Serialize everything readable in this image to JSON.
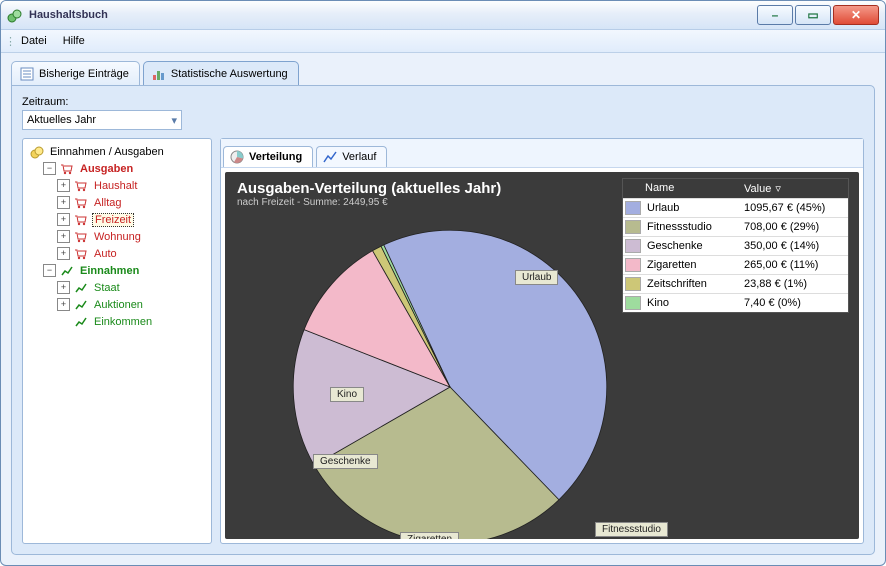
{
  "window": {
    "title": "Haushaltsbuch"
  },
  "menubar": {
    "items": [
      "Datei",
      "Hilfe"
    ]
  },
  "main_tabs": {
    "previous": "Bisherige Einträge",
    "stats": "Statistische Auswertung"
  },
  "period": {
    "label": "Zeitraum:",
    "value": "Aktuelles Jahr"
  },
  "tree": {
    "root": "Einnahmen / Ausgaben",
    "ausgaben": {
      "label": "Ausgaben",
      "children": [
        "Haushalt",
        "Alltag",
        "Freizeit",
        "Wohnung",
        "Auto"
      ]
    },
    "einnahmen": {
      "label": "Einnahmen",
      "children": [
        "Staat",
        "Auktionen",
        "Einkommen"
      ]
    }
  },
  "sub_tabs": {
    "distribution": "Verteilung",
    "history": "Verlauf"
  },
  "chart": {
    "title": "Ausgaben-Verteilung (aktuelles Jahr)",
    "subtitle": "nach Freizeit - Summe: 2449,95 €",
    "legend_headers": {
      "name": "Name",
      "value": "Value"
    },
    "rows": [
      {
        "name": "Urlaub",
        "value": "1095,67 € (45%)",
        "color": "#a3aee0"
      },
      {
        "name": "Fitnessstudio",
        "value": "708,00 € (29%)",
        "color": "#b7bb8f"
      },
      {
        "name": "Geschenke",
        "value": "350,00 € (14%)",
        "color": "#cdbcd3"
      },
      {
        "name": "Zigaretten",
        "value": "265,00 € (11%)",
        "color": "#f3b9c9"
      },
      {
        "name": "Zeitschriften",
        "value": "23,88 € (1%)",
        "color": "#cdc777"
      },
      {
        "name": "Kino",
        "value": "7,40 € (0%)",
        "color": "#9edc9e"
      }
    ]
  },
  "chart_data": {
    "type": "pie",
    "title": "Ausgaben-Verteilung (aktuelles Jahr)",
    "subtitle": "nach Freizeit - Summe: 2449,95 €",
    "total": 2449.95,
    "categories": [
      "Urlaub",
      "Fitnessstudio",
      "Geschenke",
      "Zigaretten",
      "Zeitschriften",
      "Kino"
    ],
    "values": [
      1095.67,
      708.0,
      350.0,
      265.0,
      23.88,
      7.4
    ],
    "percent": [
      45,
      29,
      14,
      11,
      1,
      0
    ],
    "colors": [
      "#a3aee0",
      "#b7bb8f",
      "#cdbcd3",
      "#f3b9c9",
      "#cdc777",
      "#9edc9e"
    ],
    "legend_position": "top-right"
  }
}
